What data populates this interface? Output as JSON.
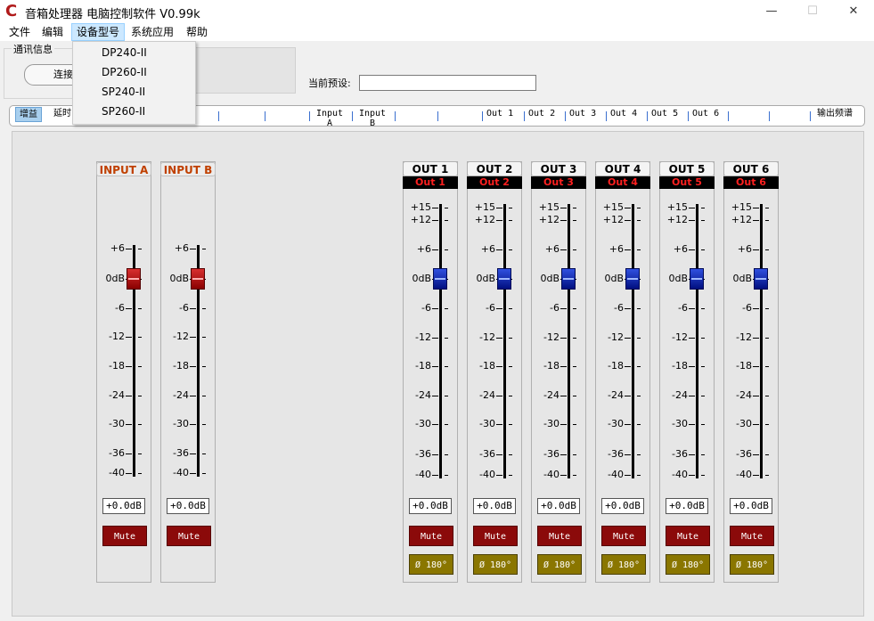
{
  "window": {
    "title": "音箱处理器 电脑控制软件 V0.99k",
    "logo": "C",
    "minimize": "—",
    "maximize": "☐",
    "close": "✕"
  },
  "menu": [
    "文件",
    "编辑",
    "设备型号",
    "系统应用",
    "帮助"
  ],
  "device_menu": [
    "DP240-II",
    "DP260-II",
    "SP240-II",
    "SP260-II"
  ],
  "comm": {
    "legend": "通讯信息",
    "connect_label": "连接"
  },
  "preset": {
    "label": "当前预设:",
    "value": ""
  },
  "tabs": [
    "增益",
    "延时",
    "Input A",
    "Input B",
    "Out 1",
    "Out 2",
    "Out 3",
    "Out 4",
    "Out 5",
    "Out 6",
    "输出频谱"
  ],
  "scale_labels": {
    "inputs": [
      "+6",
      "0dB",
      "-6",
      "-12",
      "-18",
      "-24",
      "-30",
      "-36",
      "-40"
    ],
    "outputs": [
      "+15",
      "+12",
      "+6",
      "0dB",
      "-6",
      "-12",
      "-18",
      "-24",
      "-30",
      "-36",
      "-40"
    ]
  },
  "inputs": [
    {
      "name": "INPUT A",
      "gain": "+0.0dB",
      "mute": "Mute",
      "level_db": 0
    },
    {
      "name": "INPUT B",
      "gain": "+0.0dB",
      "mute": "Mute",
      "level_db": 0
    }
  ],
  "outputs": [
    {
      "name": "OUT 1",
      "source": "Out 1",
      "gain": "+0.0dB",
      "mute": "Mute",
      "phase": "Ø 180°",
      "level_db": 0
    },
    {
      "name": "OUT 2",
      "source": "Out 2",
      "gain": "+0.0dB",
      "mute": "Mute",
      "phase": "Ø 180°",
      "level_db": 0
    },
    {
      "name": "OUT 3",
      "source": "Out 3",
      "gain": "+0.0dB",
      "mute": "Mute",
      "phase": "Ø 180°",
      "level_db": 0
    },
    {
      "name": "OUT 4",
      "source": "Out 4",
      "gain": "+0.0dB",
      "mute": "Mute",
      "phase": "Ø 180°",
      "level_db": 0
    },
    {
      "name": "OUT 5",
      "source": "Out 5",
      "gain": "+0.0dB",
      "mute": "Mute",
      "phase": "Ø 180°",
      "level_db": 0
    },
    {
      "name": "OUT 6",
      "source": "Out 6",
      "gain": "+0.0dB",
      "mute": "Mute",
      "phase": "Ø 180°",
      "level_db": 0
    }
  ],
  "colors": {
    "input_knob": "#c81e1e",
    "output_knob": "#1a2fc8",
    "mute": "#8b0a0a",
    "phase": "#8a7600",
    "input_title": "#c04000",
    "output_source": "#ff2020"
  }
}
